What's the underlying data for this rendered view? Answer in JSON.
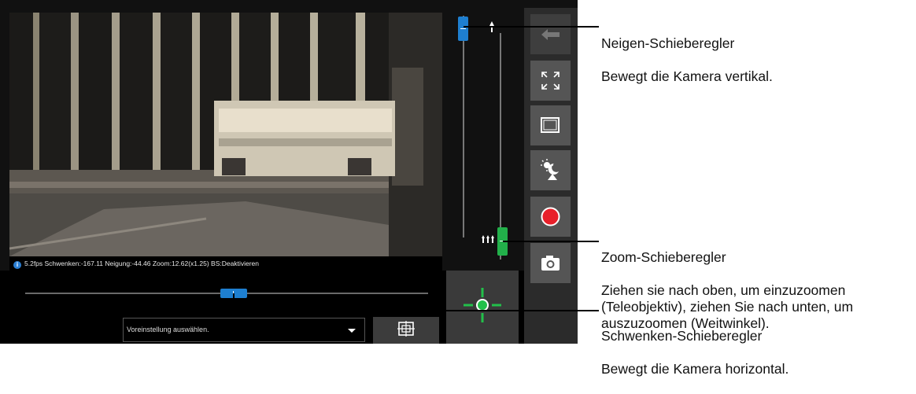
{
  "status": {
    "text": "5.2fps Schwenken:-167.11 Neigung:-44.46 Zoom:12.62(x1.25) BS:Deaktivieren"
  },
  "preset": {
    "placeholder": "Voreinstellung auswählen."
  },
  "pan": {
    "position": 0.5
  },
  "tilt": {
    "position": 0.03
  },
  "zoom": {
    "position": 0.93
  },
  "callouts": {
    "tilt_title": "Neigen-Schieberegler",
    "tilt_desc": "Bewegt die Kamera vertikal.",
    "zoom_title": "Zoom-Schieberegler",
    "zoom_desc": "Ziehen sie nach oben, um einzuzoomen\n(Teleobjektiv), ziehen Sie nach unten, um\nauszuzoomen (Weitwinkel).",
    "pan_title": "Schwenken-Schieberegler",
    "pan_desc": "Bewegt die Kamera horizontal."
  },
  "colors": {
    "pan_tilt_handle": "#1e7fd0",
    "zoom_handle": "#22b04a",
    "record": "#e8202a",
    "crosshair": "#22c04a"
  },
  "icons": [
    "back-arrow-icon",
    "fullscreen-icon",
    "frame-icon",
    "day-night-icon",
    "record-icon",
    "camera-icon",
    "preset-grid-icon",
    "crosshair-icon",
    "tele-icon",
    "wide-icon",
    "info-icon"
  ]
}
